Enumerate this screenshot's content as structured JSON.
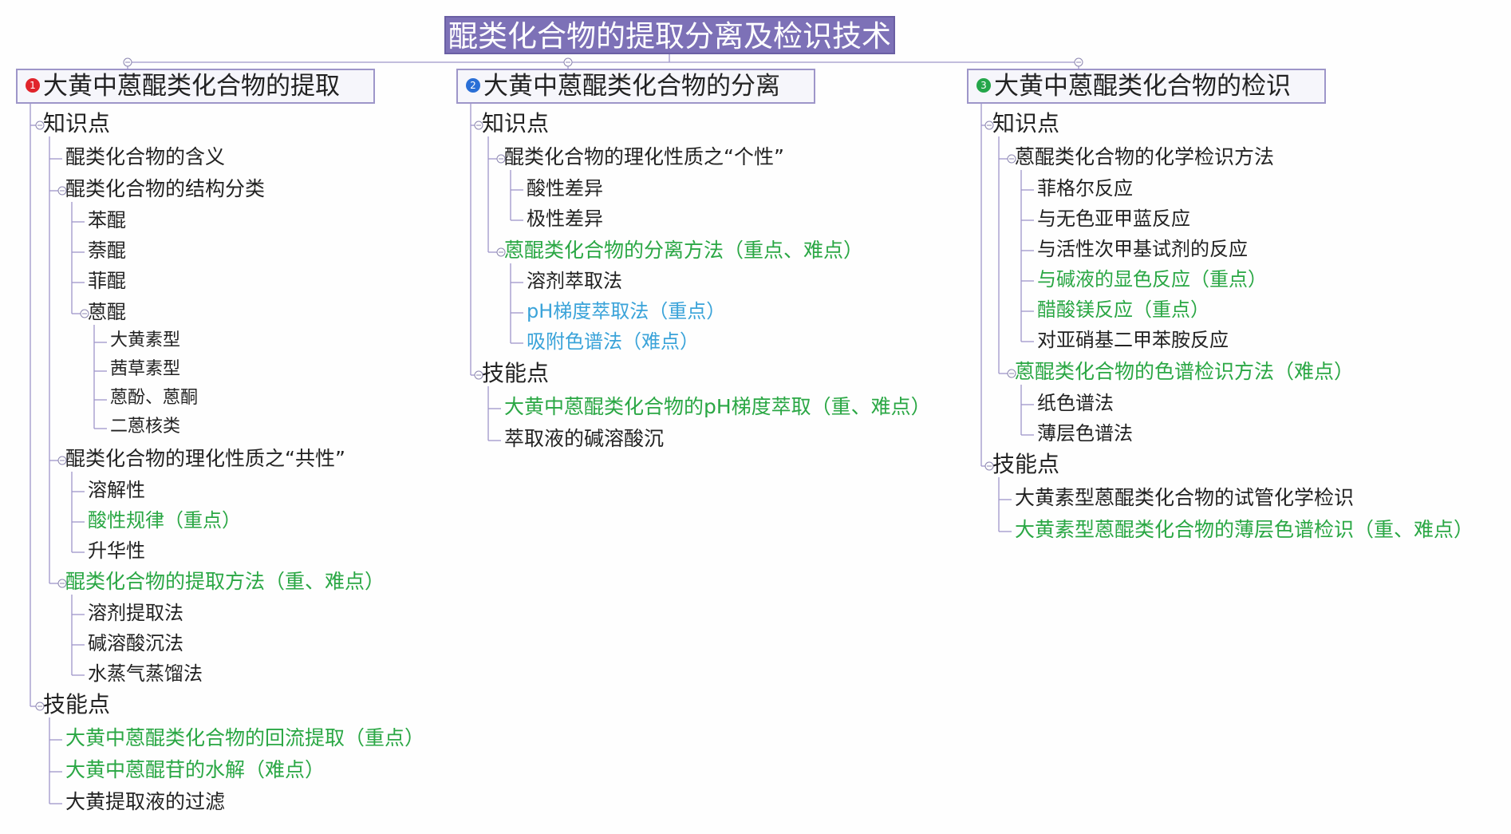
{
  "root": {
    "title": "醌类化合物的提取分离及检识技术"
  },
  "colors": {
    "root_bg": "#7d71b7",
    "line": "#9e96c9",
    "highlight_green": "#2aa744",
    "highlight_blue": "#3aa3d9",
    "badge_red": "#e0242b",
    "badge_blue": "#2a6fd6",
    "badge_green": "#24a64a"
  },
  "branches": [
    {
      "badge": "1",
      "title": "大黄中蒽醌类化合物的提取",
      "nodes": [
        {
          "label": "知识点"
        },
        {
          "label": "醌类化合物的含义"
        },
        {
          "label": "醌类化合物的结构分类"
        },
        {
          "label": "苯醌"
        },
        {
          "label": "萘醌"
        },
        {
          "label": "菲醌"
        },
        {
          "label": "蒽醌"
        },
        {
          "label": "大黄素型"
        },
        {
          "label": "茜草素型"
        },
        {
          "label": "蒽酚、蒽酮"
        },
        {
          "label": "二蒽核类"
        },
        {
          "label": "醌类化合物的理化性质之“共性”"
        },
        {
          "label": "溶解性"
        },
        {
          "label": "酸性规律（重点）"
        },
        {
          "label": "升华性"
        },
        {
          "label": "醌类化合物的提取方法（重、难点）"
        },
        {
          "label": "溶剂提取法"
        },
        {
          "label": "碱溶酸沉法"
        },
        {
          "label": "水蒸气蒸馏法"
        },
        {
          "label": "技能点"
        },
        {
          "label": "大黄中蒽醌类化合物的回流提取（重点）"
        },
        {
          "label": "大黄中蒽醌苷的水解（难点）"
        },
        {
          "label": "大黄提取液的过滤"
        }
      ]
    },
    {
      "badge": "2",
      "title": "大黄中蒽醌类化合物的分离",
      "nodes": [
        {
          "label": "知识点"
        },
        {
          "label": "醌类化合物的理化性质之“个性”"
        },
        {
          "label": "酸性差异"
        },
        {
          "label": "极性差异"
        },
        {
          "label": "蒽醌类化合物的分离方法（重点、难点）"
        },
        {
          "label": "溶剂萃取法"
        },
        {
          "label": "pH梯度萃取法（重点）"
        },
        {
          "label": "吸附色谱法（难点）"
        },
        {
          "label": "技能点"
        },
        {
          "label": "大黄中蒽醌类化合物的pH梯度萃取（重、难点）"
        },
        {
          "label": "萃取液的碱溶酸沉"
        }
      ]
    },
    {
      "badge": "3",
      "title": "大黄中蒽醌类化合物的检识",
      "nodes": [
        {
          "label": "知识点"
        },
        {
          "label": "蒽醌类化合物的化学检识方法"
        },
        {
          "label": "菲格尔反应"
        },
        {
          "label": "与无色亚甲蓝反应"
        },
        {
          "label": "与活性次甲基试剂的反应"
        },
        {
          "label": "与碱液的显色反应（重点）"
        },
        {
          "label": "醋酸镁反应（重点）"
        },
        {
          "label": "对亚硝基二甲苯胺反应"
        },
        {
          "label": "蒽醌类化合物的色谱检识方法（难点）"
        },
        {
          "label": "纸色谱法"
        },
        {
          "label": "薄层色谱法"
        },
        {
          "label": "技能点"
        },
        {
          "label": "大黄素型蒽醌类化合物的试管化学检识"
        },
        {
          "label": "大黄素型蒽醌类化合物的薄层色谱检识（重、难点）"
        }
      ]
    }
  ]
}
